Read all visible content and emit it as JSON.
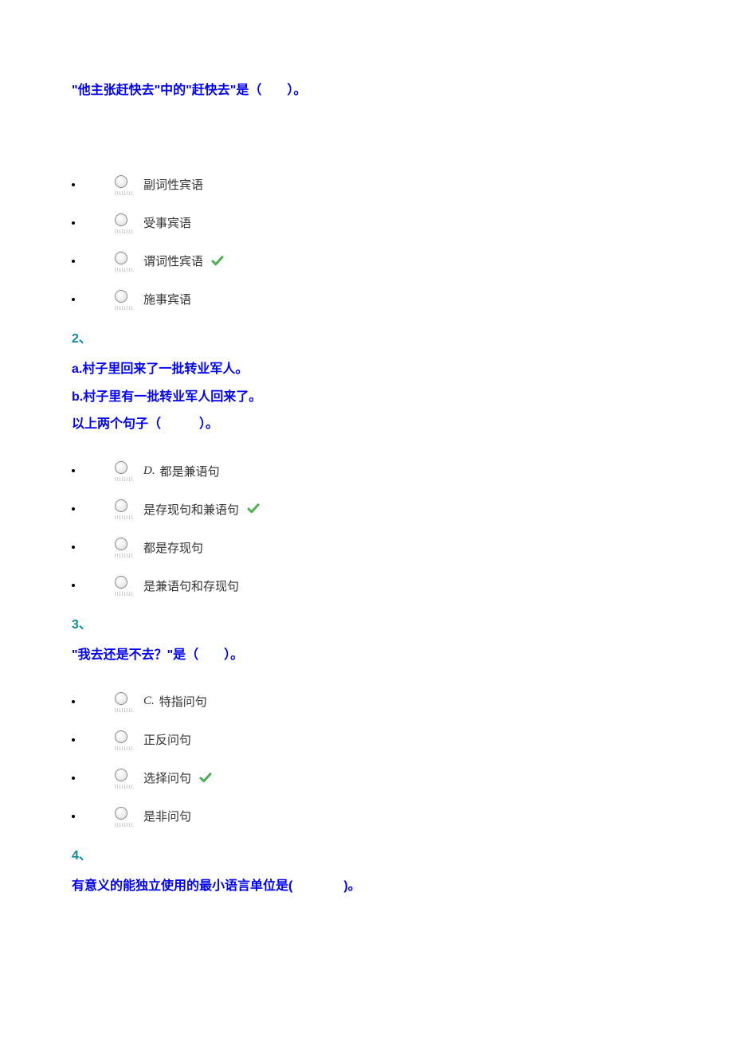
{
  "questions": [
    {
      "number": "",
      "lines": [
        "\"他主张赶快去\"中的\"赶快去\"是（　　）。"
      ],
      "options": [
        {
          "prefix": "",
          "text": "副词性宾语",
          "correct": false
        },
        {
          "prefix": "",
          "text": "受事宾语",
          "correct": false
        },
        {
          "prefix": "",
          "text": "谓词性宾语",
          "correct": true
        },
        {
          "prefix": "",
          "text": "施事宾语",
          "correct": false
        }
      ]
    },
    {
      "number": "2、",
      "lines": [
        "a.村子里回来了一批转业军人。",
        "b.村子里有一批转业军人回来了。",
        "以上两个句子（　　　）。"
      ],
      "options": [
        {
          "prefix": "D.",
          "text": "都是兼语句",
          "correct": false
        },
        {
          "prefix": "",
          "text": "是存现句和兼语句",
          "correct": true
        },
        {
          "prefix": "",
          "text": "都是存现句",
          "correct": false
        },
        {
          "prefix": "",
          "text": "是兼语句和存现句",
          "correct": false
        }
      ]
    },
    {
      "number": "3、",
      "lines": [
        "\"我去还是不去？\"是（　　）。"
      ],
      "options": [
        {
          "prefix": "C.",
          "text": "特指问句",
          "correct": false
        },
        {
          "prefix": "",
          "text": "正反问句",
          "correct": false
        },
        {
          "prefix": "",
          "text": "选择问句",
          "correct": true
        },
        {
          "prefix": "",
          "text": "是非问句",
          "correct": false
        }
      ]
    },
    {
      "number": "4、",
      "lines": [
        "有意义的能独立使用的最小语言单位是(　　　　)。"
      ],
      "options": []
    }
  ]
}
